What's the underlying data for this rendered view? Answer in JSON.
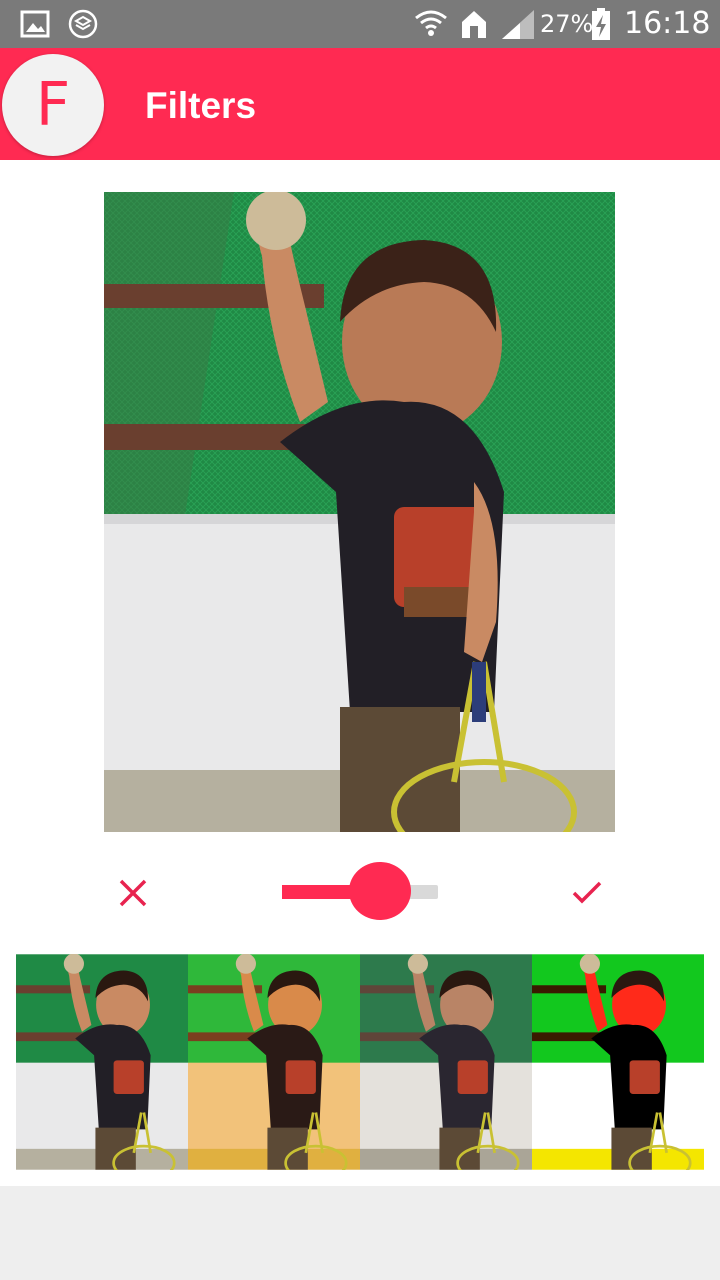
{
  "status_bar": {
    "battery": "27%",
    "time": "16:18",
    "icons": [
      "gallery-notification-icon",
      "layers-notification-icon",
      "wifi-icon",
      "home-icon",
      "signal-icon",
      "battery-charging-icon"
    ]
  },
  "app_bar": {
    "logo_letter": "F",
    "title": "Filters"
  },
  "editor": {
    "cancel_icon": "close-icon",
    "confirm_icon": "check-icon",
    "intensity_fraction": 0.63
  },
  "filters": [
    {
      "name": "original",
      "selected": false
    },
    {
      "name": "warm",
      "selected": false
    },
    {
      "name": "vintage",
      "selected": false
    },
    {
      "name": "high-contrast",
      "selected": false
    }
  ],
  "colors": {
    "accent": "#ff2a52",
    "status_bar": "#7a7a7a",
    "background": "#eeeeee"
  }
}
